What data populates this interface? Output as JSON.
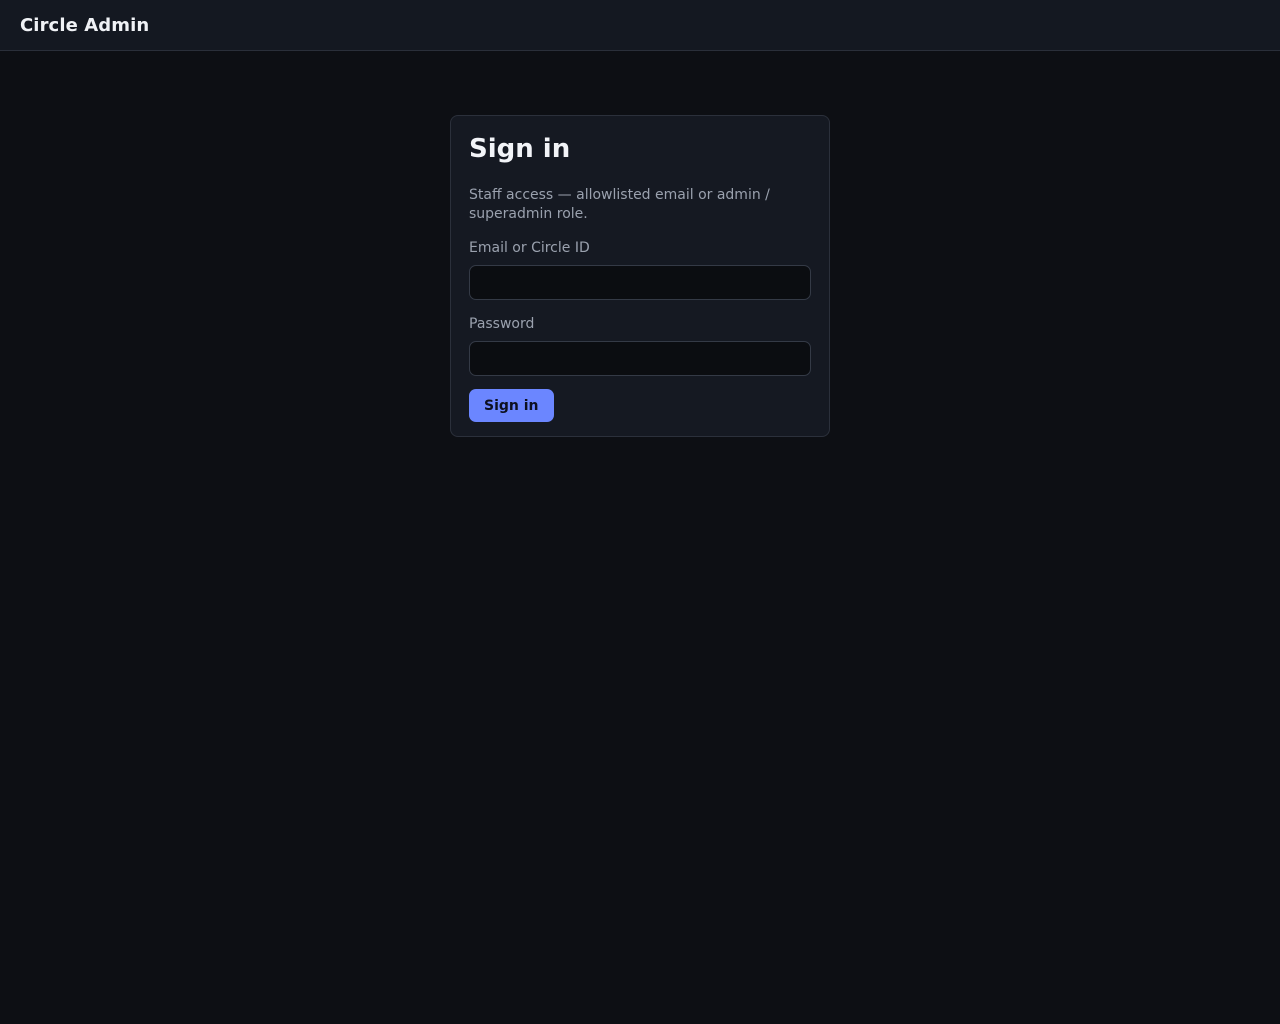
{
  "header": {
    "brand": "Circle Admin"
  },
  "signin": {
    "title": "Sign in",
    "description": "Staff access — allowlisted email or admin / superadmin role.",
    "email_label": "Email or Circle ID",
    "email_value": "",
    "email_placeholder": "",
    "password_label": "Password",
    "password_value": "",
    "password_placeholder": "",
    "submit_label": "Sign in"
  },
  "colors": {
    "background": "#0d0f14",
    "header_background": "#141821",
    "card_background": "#151922",
    "accent": "#6b86ff"
  }
}
